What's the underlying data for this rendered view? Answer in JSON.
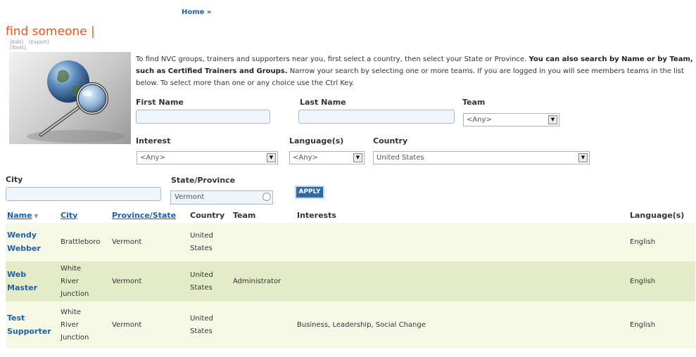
{
  "breadcrumb": {
    "home": "Home",
    "separator": "»"
  },
  "page": {
    "title": "find someone |",
    "edit_link": "[Edit]",
    "export_link": "[Export]",
    "tools_link": "[Tools]"
  },
  "intro": {
    "part1": "To find NVC groups, trainers and supporters near you, first select a country, then select your State or Province. ",
    "bold": "You can also search by Name or by Team, such as Certified Trainers and Groups.",
    "part2": " Narrow your search by selecting one or more teams. If you are logged in you will see members teams in the list below. To select more than one or any choice use the Ctrl Key."
  },
  "form": {
    "first_name_label": "First Name",
    "last_name_label": "Last Name",
    "team_label": "Team",
    "team_value": "<Any>",
    "interest_label": "Interest",
    "interest_value": "<Any>",
    "language_label": "Language(s)",
    "language_value": "<Any>",
    "country_label": "Country",
    "country_value": "United States",
    "city_label": "City",
    "state_label": "State/Province",
    "state_value": "Vermont",
    "apply_label": "APPLY"
  },
  "table": {
    "headers": {
      "name": "Name",
      "city": "City",
      "province": "Province/State",
      "country": "Country",
      "team": "Team",
      "interests": "Interests",
      "languages": "Language(s)"
    },
    "rows": [
      {
        "name_first": "Wendy",
        "name_last": "Webber",
        "city": "Brattleboro",
        "province": "Vermont",
        "country_1": "United",
        "country_2": "States",
        "team": "",
        "interests": "",
        "language": "English"
      },
      {
        "name_first": "Web",
        "name_last": "Master",
        "city_1": "White",
        "city_2": "River",
        "city_3": "Junction",
        "province": "Vermont",
        "country_1": "United",
        "country_2": "States",
        "team": "Administrator",
        "interests": "",
        "language": "English"
      },
      {
        "name_first": "Test",
        "name_last": "Supporter",
        "city_1": "White",
        "city_2": "River",
        "city_3": "Junction",
        "province": "Vermont",
        "country_1": "United",
        "country_2": "States",
        "team": "",
        "interests": "Business, Leadership, Social Change",
        "language": "English"
      }
    ]
  }
}
